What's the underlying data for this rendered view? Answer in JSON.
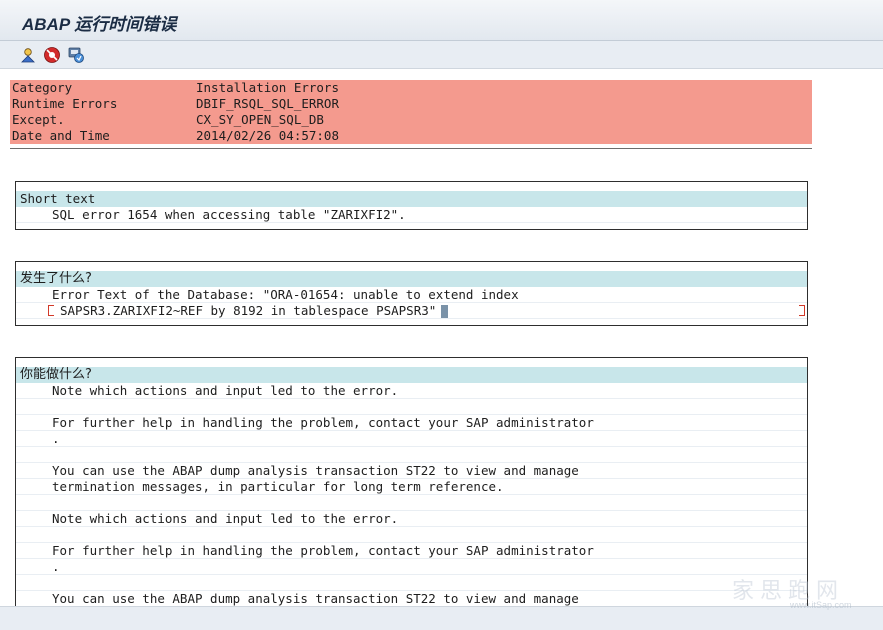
{
  "window": {
    "title": "ABAP 运行时间错误"
  },
  "toolbar": {
    "buttons": [
      "person-debug-icon",
      "red-stop-icon",
      "save-local-icon"
    ]
  },
  "header": {
    "rows": [
      {
        "key": "Category",
        "value": "Installation Errors"
      },
      {
        "key": "Runtime Errors",
        "value": "DBIF_RSQL_SQL_ERROR"
      },
      {
        "key": "Except.",
        "value": "CX_SY_OPEN_SQL_DB"
      },
      {
        "key": "Date and Time",
        "value": "2014/02/26 04:57:08"
      }
    ]
  },
  "short_text": {
    "heading": "Short text",
    "lines": [
      "SQL error 1654 when accessing table \"ZARIXFI2\"."
    ]
  },
  "what_happened": {
    "heading": "发生了什么?",
    "lines": [
      "Error Text of the Database: \"ORA-01654: unable to extend index",
      "SAPSR3.ZARIXFI2~REF by 8192 in tablespace PSAPSR3\""
    ]
  },
  "what_to_do": {
    "heading": "你能做什么?",
    "lines": [
      "Note which actions and input led to the error.",
      "",
      "For further help in handling the problem, contact your SAP administrator",
      ".",
      "",
      "You can use the ABAP dump analysis transaction ST22 to view and manage",
      "termination messages, in particular for long term reference.",
      "",
      "Note which actions and input led to the error.",
      "",
      "For further help in handling the problem, contact your SAP administrator",
      ".",
      "",
      "You can use the ABAP dump analysis transaction ST22 to view and manage"
    ]
  },
  "watermark": {
    "text": "家思跑网",
    "sub": "www.itSap.com"
  },
  "colors": {
    "header_bg": "#f49a8e",
    "section_head_bg": "#c8e6ea",
    "cursor": "#7a92a8"
  }
}
